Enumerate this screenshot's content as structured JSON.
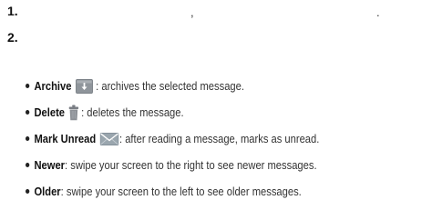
{
  "steps": [
    {
      "number": "1.",
      "punctuation": [
        ",",
        "."
      ]
    },
    {
      "number": "2."
    }
  ],
  "actions": [
    {
      "term": "Archive",
      "icon": "archive-icon",
      "description": ": archives the selected message."
    },
    {
      "term": "Delete",
      "icon": "trash-icon",
      "description": ": deletes the message."
    },
    {
      "term": "Mark Unread",
      "icon": "envelope-icon",
      "description": ": after reading a message, marks as unread."
    },
    {
      "term": "Newer",
      "description": ": swipe your screen to the right to see newer messages."
    },
    {
      "term": "Older",
      "description": ": swipe your screen to the left to see older messages."
    }
  ],
  "colors": {
    "archive_icon": "#8f959b",
    "delete_icon": "#8c9096",
    "envelope_icon": "#9aa6ae"
  }
}
